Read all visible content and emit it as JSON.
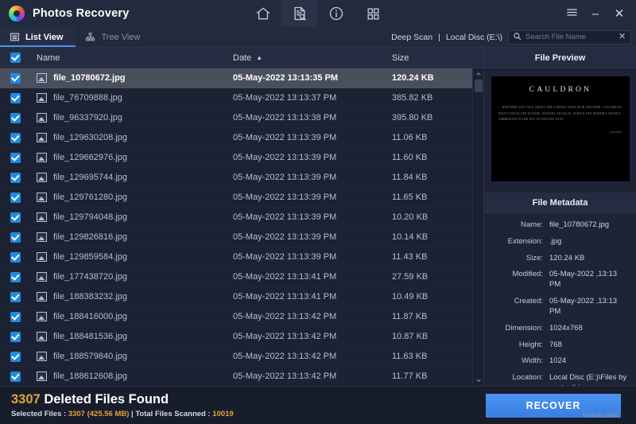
{
  "titlebar": {
    "app_title": "Photos Recovery",
    "logo_icon": "photos-recovery-logo",
    "nav": [
      {
        "icon": "home-icon",
        "name": "home",
        "active": false
      },
      {
        "icon": "document-search-icon",
        "name": "scan",
        "active": true
      },
      {
        "icon": "info-circle-icon",
        "name": "info",
        "active": false
      },
      {
        "icon": "grid-icon",
        "name": "grid",
        "active": false
      }
    ],
    "window": {
      "menu_icon": "hamburger-menu-icon",
      "minimize_label": "–",
      "close_label": "✕"
    }
  },
  "toolbar": {
    "tabs": [
      {
        "label": "List View",
        "icon": "list-view-icon",
        "active": true
      },
      {
        "label": "Tree View",
        "icon": "tree-view-icon",
        "active": false
      }
    ],
    "scan_mode": "Deep Scan",
    "separator": "|",
    "drive": "Local Disc (E:\\)",
    "search": {
      "icon": "search-icon",
      "placeholder": "Search File Name",
      "value": "",
      "clear_icon": "close-icon"
    }
  },
  "list": {
    "header": {
      "select_all_checked": true,
      "name": "Name",
      "date": "Date",
      "sort_indicator": "▲",
      "size": "Size"
    },
    "rows": [
      {
        "name": "file_10780672.jpg",
        "date": "05-May-2022 13:13:35 PM",
        "size": "120.24 KB",
        "checked": true,
        "selected": true
      },
      {
        "name": "file_76709888.jpg",
        "date": "05-May-2022 13:13:37 PM",
        "size": "385.82 KB",
        "checked": true,
        "selected": false
      },
      {
        "name": "file_96337920.jpg",
        "date": "05-May-2022 13:13:38 PM",
        "size": "395.80 KB",
        "checked": true,
        "selected": false
      },
      {
        "name": "file_129630208.jpg",
        "date": "05-May-2022 13:13:39 PM",
        "size": "11.06 KB",
        "checked": true,
        "selected": false
      },
      {
        "name": "file_129662976.jpg",
        "date": "05-May-2022 13:13:39 PM",
        "size": "11.60 KB",
        "checked": true,
        "selected": false
      },
      {
        "name": "file_129695744.jpg",
        "date": "05-May-2022 13:13:39 PM",
        "size": "11.84 KB",
        "checked": true,
        "selected": false
      },
      {
        "name": "file_129761280.jpg",
        "date": "05-May-2022 13:13:39 PM",
        "size": "11.65 KB",
        "checked": true,
        "selected": false
      },
      {
        "name": "file_129794048.jpg",
        "date": "05-May-2022 13:13:39 PM",
        "size": "10.20 KB",
        "checked": true,
        "selected": false
      },
      {
        "name": "file_129826816.jpg",
        "date": "05-May-2022 13:13:39 PM",
        "size": "10.14 KB",
        "checked": true,
        "selected": false
      },
      {
        "name": "file_129859584.jpg",
        "date": "05-May-2022 13:13:39 PM",
        "size": "11.43 KB",
        "checked": true,
        "selected": false
      },
      {
        "name": "file_177438720.jpg",
        "date": "05-May-2022 13:13:41 PM",
        "size": "27.59 KB",
        "checked": true,
        "selected": false
      },
      {
        "name": "file_188383232.jpg",
        "date": "05-May-2022 13:13:41 PM",
        "size": "10.49 KB",
        "checked": true,
        "selected": false
      },
      {
        "name": "file_188416000.jpg",
        "date": "05-May-2022 13:13:42 PM",
        "size": "11.87 KB",
        "checked": true,
        "selected": false
      },
      {
        "name": "file_188481536.jpg",
        "date": "05-May-2022 13:13:42 PM",
        "size": "10.87 KB",
        "checked": true,
        "selected": false
      },
      {
        "name": "file_188579840.jpg",
        "date": "05-May-2022 13:13:42 PM",
        "size": "11.63 KB",
        "checked": true,
        "selected": false
      },
      {
        "name": "file_188612608.jpg",
        "date": "05-May-2022 13:13:42 PM",
        "size": "11.77 KB",
        "checked": true,
        "selected": false
      }
    ],
    "scrollbar": {
      "up_icon": "chevron-up-icon",
      "down_icon": "chevron-down-icon"
    }
  },
  "preview": {
    "title": "File Preview",
    "image": {
      "heading": "CAULDRON",
      "body": "... WHETHER YOU TALK ABOUT THE EARTHLY REALM OR ANOTHER, CAULDRONS HAVE CONCOCTED ELIXIRS, POTIONS, MAGICAL TONICS AND POSSIBLY DEADLY AMBROSIAS IN THE NOT SO DISTANT PAST.",
      "signature": "- SARAH'S"
    }
  },
  "metadata": {
    "title": "File Metadata",
    "rows": [
      {
        "key": "Name:",
        "value": "file_10780672.jpg"
      },
      {
        "key": "Extension:",
        "value": ".jpg"
      },
      {
        "key": "Size:",
        "value": "120.24 KB"
      },
      {
        "key": "Modified:",
        "value": "05-May-2022 ,13:13 PM"
      },
      {
        "key": "Created:",
        "value": "05-May-2022 ,13:13 PM"
      },
      {
        "key": "Dimension:",
        "value": "1024x768"
      },
      {
        "key": "Height:",
        "value": "768"
      },
      {
        "key": "Width:",
        "value": "1024"
      },
      {
        "key": "Location:",
        "value": "Local Disc (E:)\\Files by content\\.jpg"
      }
    ]
  },
  "footer": {
    "found_count": "3307",
    "found_text": "Deleted Files Found",
    "selected_label": "Selected Files : ",
    "selected_value": "3307 (425.56 MB)",
    "mid_separator": " | ",
    "scanned_label": "Total Files Scanned : ",
    "scanned_value": "10019",
    "recover_label": "RECOVER",
    "watermark": "wsxdn.com"
  },
  "colors": {
    "accent_blue": "#3a7fe0",
    "checkbox_blue": "#1f8ae0",
    "amber": "#e2a33a",
    "bg_dark": "#1c2234",
    "bar_bg": "#222a3e",
    "row_selected": "#4a4f5e"
  }
}
